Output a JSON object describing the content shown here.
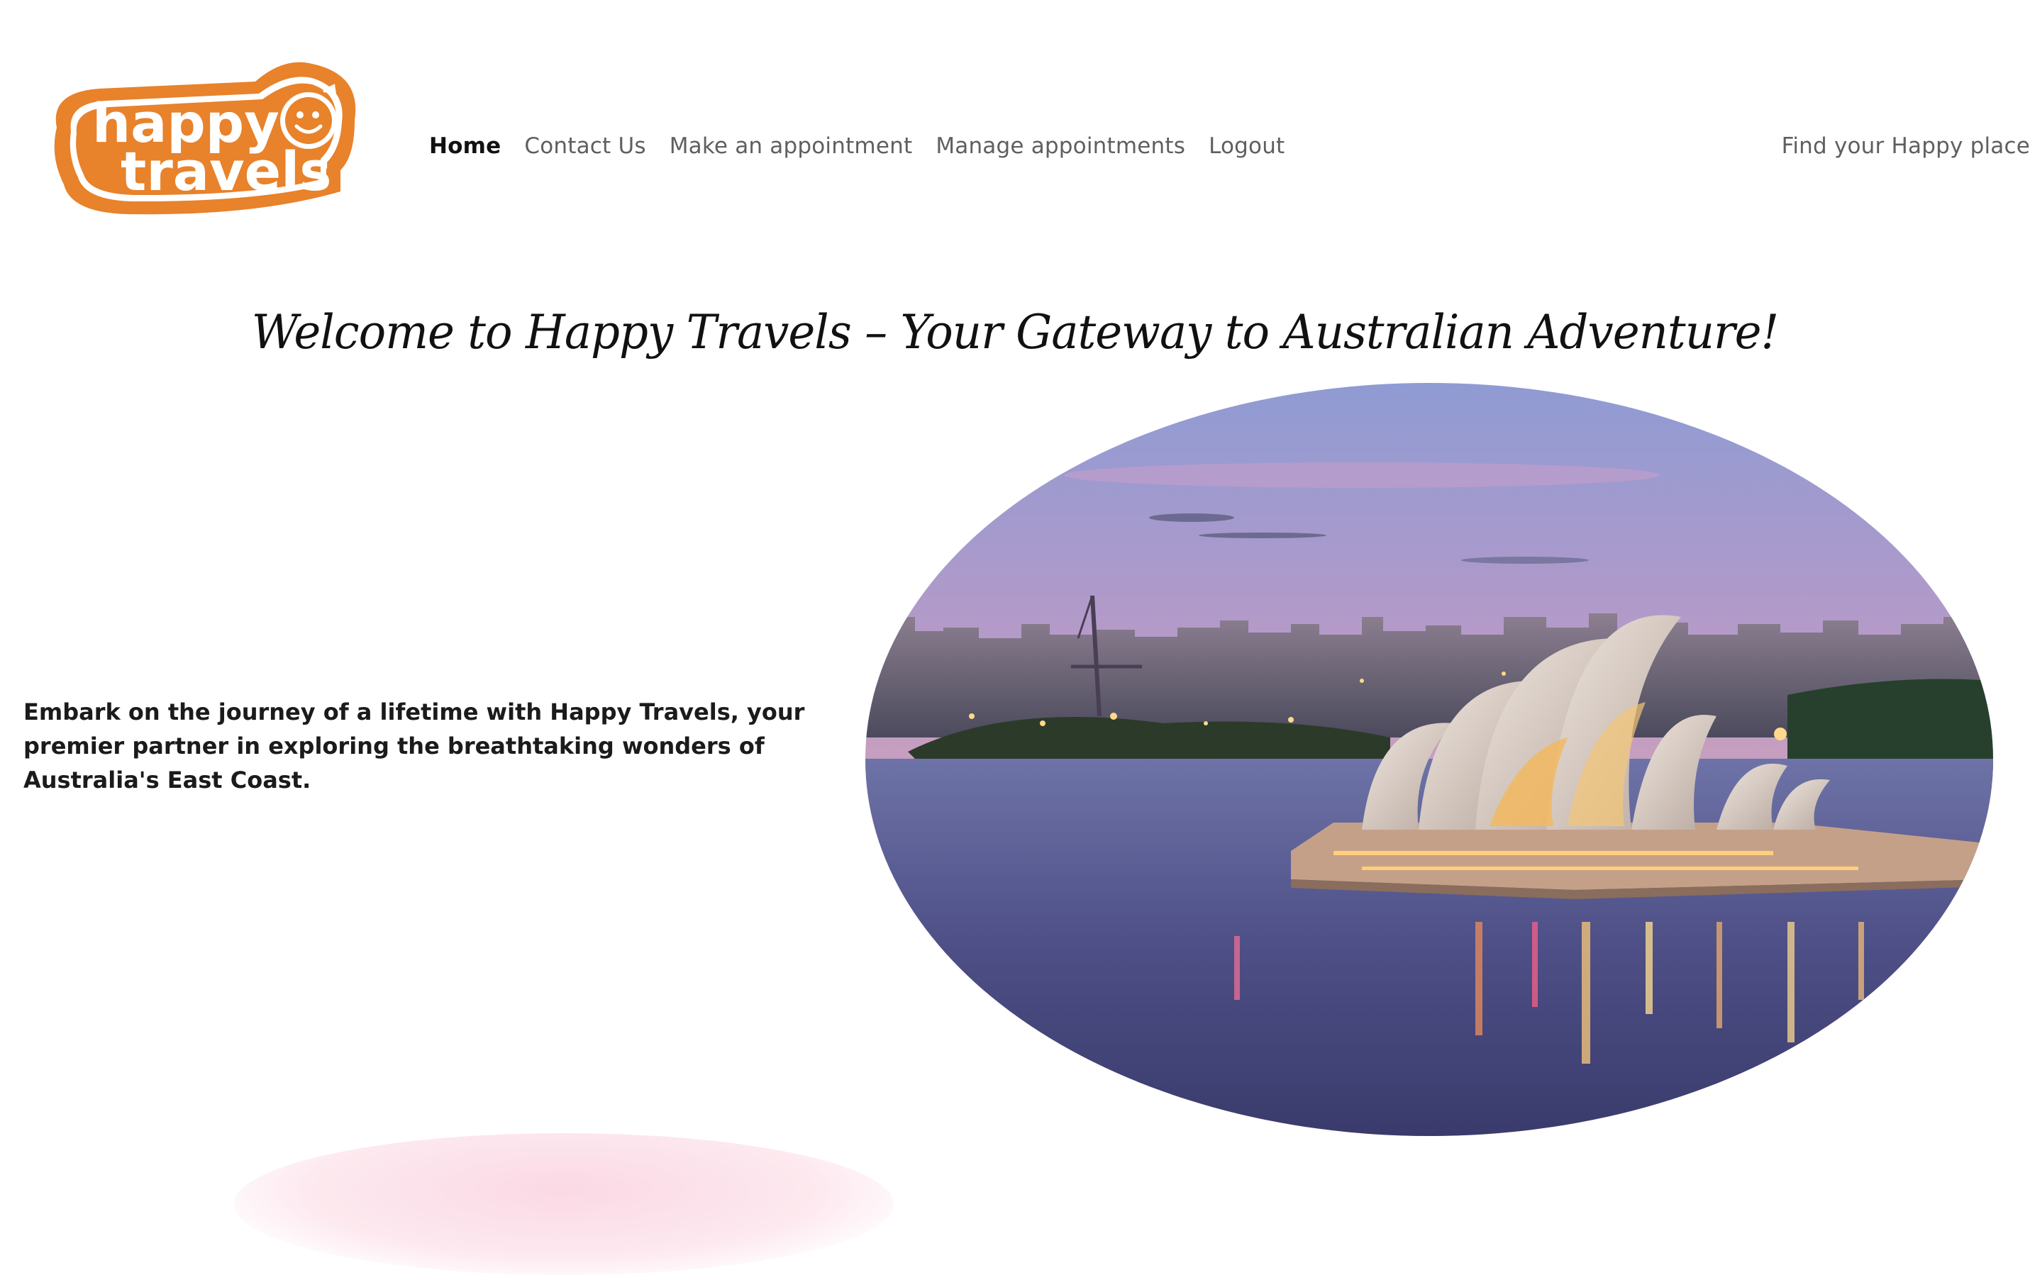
{
  "brand": {
    "logo_line1": "happy",
    "logo_line2": "travels",
    "color": "#e8822b"
  },
  "nav": {
    "items": [
      {
        "label": "Home",
        "active": true
      },
      {
        "label": "Contact Us",
        "active": false
      },
      {
        "label": "Make an appointment",
        "active": false
      },
      {
        "label": "Manage appointments",
        "active": false
      },
      {
        "label": "Logout",
        "active": false
      }
    ]
  },
  "header": {
    "tagline": "Find your Happy place"
  },
  "hero": {
    "title": "Welcome to Happy Travels – Your Gateway to Australian Adventure!",
    "intro": "Embark on the journey of a lifetime with Happy Travels, your premier partner in exploring the breathtaking wonders of Australia's East Coast.",
    "image_subject": "sydney-opera-house-harbour-at-dusk"
  },
  "colors": {
    "accent": "#e8822b",
    "nav_text": "#5f5f5f",
    "nav_active": "#111111"
  }
}
